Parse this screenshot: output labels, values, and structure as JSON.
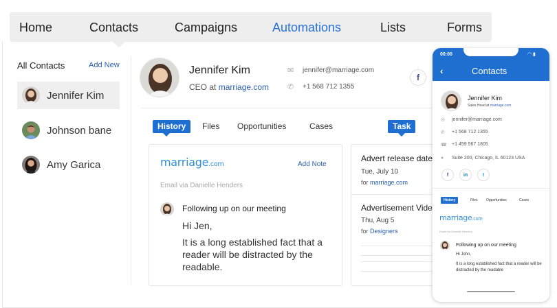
{
  "nav": {
    "tabs": [
      {
        "label": "Home"
      },
      {
        "label": "Contacts"
      },
      {
        "label": "Campaigns"
      },
      {
        "label": "Automations"
      },
      {
        "label": "Lists"
      },
      {
        "label": "Forms"
      }
    ],
    "active_index": 3
  },
  "sidebar": {
    "title": "All Contacts",
    "add_label": "Add New",
    "items": [
      {
        "label": "Jennifer Kim"
      },
      {
        "label": "Johnson bane"
      },
      {
        "label": "Amy Garica"
      }
    ]
  },
  "contact": {
    "name": "Jennifer Kim",
    "role_prefix": "CEO at",
    "company": "marriage.com",
    "email": "jennifer@marriage.com",
    "phone": "+1 568 712 1355",
    "social_icon": "facebook-icon"
  },
  "subtabs": [
    "History",
    "Files",
    "Opportunities",
    "Cases"
  ],
  "history": {
    "logo_text": "marriage",
    "logo_suffix": ".com",
    "add_note": "Add Note",
    "via": "Email via Danielle Henders",
    "subject": "Following up on our meeting",
    "greeting": "Hi Jen,",
    "body": "It is a long established fact that a reader will be distracted by the readable."
  },
  "task": {
    "tab_label": "Task",
    "items": [
      {
        "title": "Advert release date",
        "date": "Tue, July 10",
        "for_prefix": "for",
        "for_link": "marriage.com"
      },
      {
        "title": "Advertisement Video",
        "date": "Thu, Aug 5",
        "for_prefix": "for",
        "for_link": "Designers"
      }
    ]
  },
  "phone": {
    "time": "00:00",
    "title": "Contacts",
    "name": "Jennifer Kim",
    "role_prefix": "Sales Head at",
    "company": "marriage.com",
    "email": "jennifer@marriage.com",
    "phone1": "+1 568 712 1355",
    "phone2": "+1 459 567 1805",
    "address": "Suite 200, Chicago, IL 60123 USA",
    "social": [
      "f",
      "in",
      "t"
    ],
    "tabs": [
      "History",
      "Files",
      "Opportunities",
      "Cases"
    ],
    "logo_text": "marriage",
    "logo_suffix": ".com",
    "via": "Email via Danielle Henders",
    "subject": "Following up on our meeting",
    "greeting": "Hi John,",
    "body": "It is a long established fact that a reader will be distracted by the readable"
  },
  "colors": {
    "accent": "#1f6fd1",
    "link": "#2a5fb0",
    "nav_bg": "#eeeeef",
    "logo": "#2f8fd8"
  }
}
